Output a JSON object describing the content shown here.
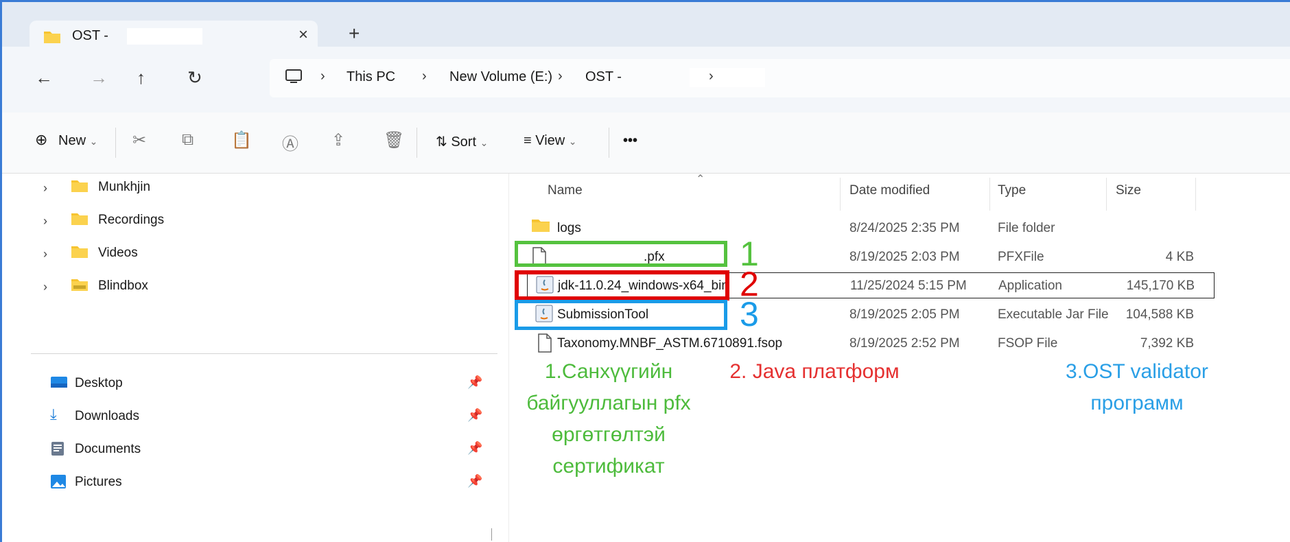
{
  "window": {
    "tab_title": "OST -",
    "close_tab": "×",
    "new_tab": "+"
  },
  "nav": {
    "back": "←",
    "forward": "→",
    "up": "↑",
    "refresh": "↻"
  },
  "breadcrumb": {
    "items": [
      "This PC",
      "New Volume (E:)",
      "OST -"
    ],
    "separator": "›"
  },
  "toolbar": {
    "new_label": "New",
    "sort_label": "Sort",
    "view_label": "View",
    "more_label": "•••",
    "icons": [
      "cut-icon",
      "copy-icon",
      "paste-icon",
      "rename-icon",
      "share-icon",
      "delete-icon"
    ]
  },
  "sidebar": {
    "tree": [
      {
        "label": "Munkhjin",
        "icon": "folder-icon"
      },
      {
        "label": "Recordings",
        "icon": "folder-icon"
      },
      {
        "label": "Videos",
        "icon": "folder-icon"
      },
      {
        "label": "Blindbox",
        "icon": "folder-icon"
      }
    ],
    "quick": [
      {
        "label": "Desktop",
        "icon": "desktop-icon"
      },
      {
        "label": "Downloads",
        "icon": "download-icon"
      },
      {
        "label": "Documents",
        "icon": "documents-icon"
      },
      {
        "label": "Pictures",
        "icon": "pictures-icon"
      }
    ]
  },
  "columns": [
    "Name",
    "Date modified",
    "Type",
    "Size"
  ],
  "files": [
    {
      "name": "logs",
      "date": "8/24/2025 2:35 PM",
      "type": "File folder",
      "size": "",
      "icon": "folder-icon"
    },
    {
      "name": ".pfx",
      "date": "8/19/2025 2:03 PM",
      "type": "PFXFile",
      "size": "4 KB",
      "icon": "file-icon"
    },
    {
      "name": "jdk-11.0.24_windows-x64_bin",
      "date": "11/25/2024 5:15 PM",
      "type": "Application",
      "size": "145,170 KB",
      "icon": "java-icon"
    },
    {
      "name": "SubmissionTool",
      "date": "8/19/2025 2:05 PM",
      "type": "Executable Jar File",
      "size": "104,588 KB",
      "icon": "java-icon"
    },
    {
      "name": "Taxonomy.MNBF_ASTM.6710891.fsop",
      "date": "8/19/2025 2:52 PM",
      "type": "FSOP File",
      "size": "7,392 KB",
      "icon": "file-icon"
    }
  ],
  "annotations": {
    "numbers": [
      "1",
      "2",
      "3"
    ],
    "notes": [
      {
        "lines": [
          "1.Санхүүгийн",
          "байгууллагын pfx",
          "өргөтгөлтэй",
          "сертификат"
        ],
        "color": "#4dbb3c"
      },
      {
        "lines": [
          "2. Java платформ"
        ],
        "color": "#e53030"
      },
      {
        "lines": [
          "3.OST validator",
          "программ"
        ],
        "color": "#2a9fe6"
      }
    ]
  },
  "colors": {
    "green": "#55c23f",
    "red": "#e00000",
    "blue": "#1a9be8"
  }
}
